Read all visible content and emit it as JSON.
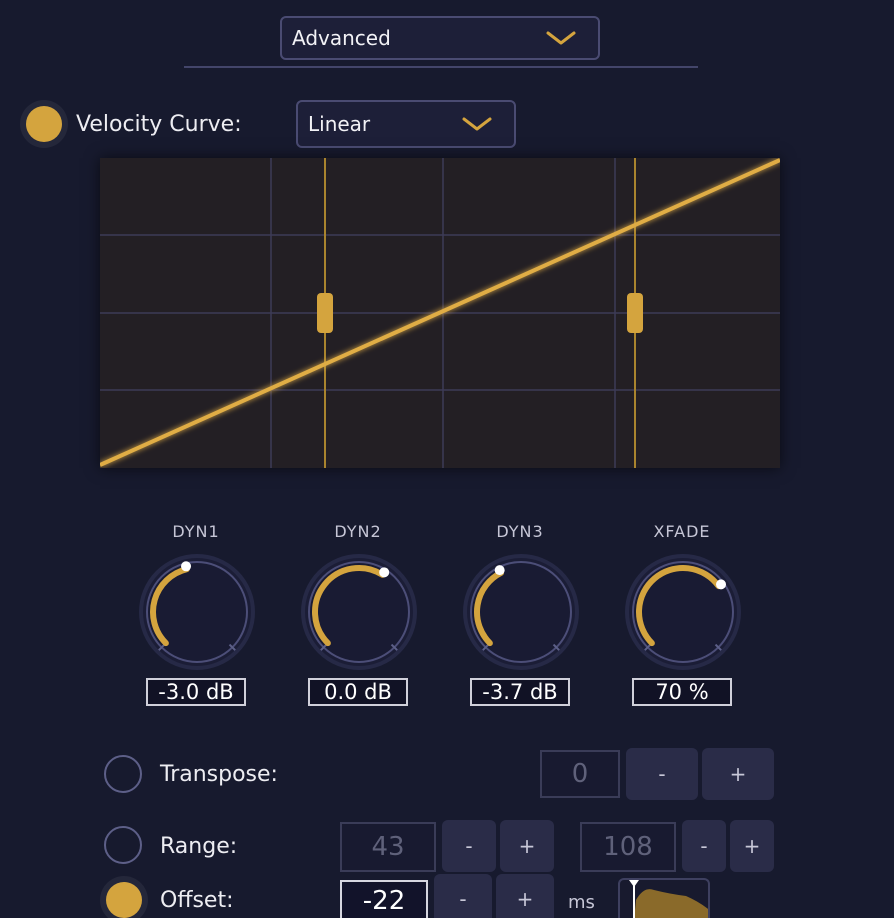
{
  "mode_dropdown": {
    "value": "Advanced"
  },
  "velocity": {
    "label": "Velocity Curve:",
    "curve_dropdown": "Linear",
    "enabled": true
  },
  "knobs": [
    {
      "title": "DYN1",
      "value": "-3.0 dB",
      "position": 0.45
    },
    {
      "title": "DYN2",
      "value": "0.0 dB",
      "position": 0.62
    },
    {
      "title": "DYN3",
      "value": "-3.7 dB",
      "position": 0.4
    },
    {
      "title": "XFADE",
      "value": "70 %",
      "position": 0.7
    }
  ],
  "transpose": {
    "label": "Transpose:",
    "value": "0",
    "minus": "-",
    "plus": "+",
    "enabled": false
  },
  "range": {
    "label": "Range:",
    "low": "43",
    "high": "108",
    "minus": "-",
    "plus": "+",
    "enabled": false
  },
  "offset": {
    "label": "Offset:",
    "value": "-22",
    "unit": "ms",
    "minus": "-",
    "plus": "+",
    "enabled": true
  },
  "colors": {
    "accent": "#d4a43e",
    "background": "#171a2e",
    "panel": "#231f24"
  }
}
